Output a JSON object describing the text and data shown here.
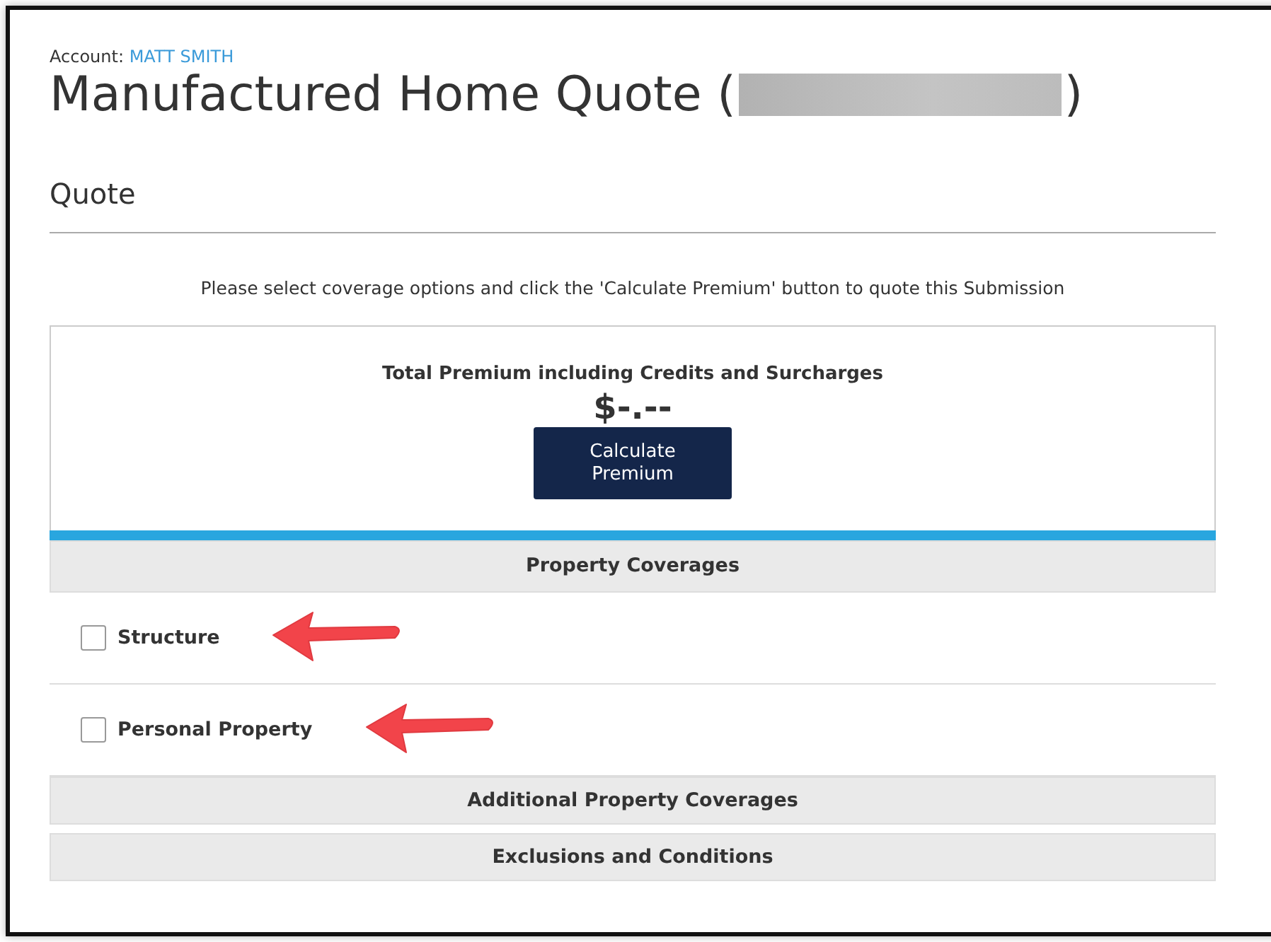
{
  "account": {
    "label": "Account:",
    "name": "MATT SMITH"
  },
  "title": {
    "text": "Manufactured Home Quote (",
    "closing": ")",
    "redacted": true
  },
  "section_title": "Quote",
  "instruction": "Please select coverage options and click the 'Calculate Premium' button to quote this Submission",
  "premium": {
    "label": "Total Premium including Credits and Surcharges",
    "amount": "$-.--",
    "button": "Calculate Premium"
  },
  "sections": [
    {
      "kind": "header",
      "label": "Property Coverages",
      "accent": true
    },
    {
      "kind": "checkbox",
      "label": "Structure",
      "checked": false,
      "arrow": true
    },
    {
      "kind": "checkbox",
      "label": "Personal Property",
      "checked": false,
      "arrow": true
    },
    {
      "kind": "header",
      "label": "Additional Property Coverages",
      "accent": false
    },
    {
      "kind": "header",
      "label": "Exclusions and Conditions",
      "accent": false
    }
  ]
}
